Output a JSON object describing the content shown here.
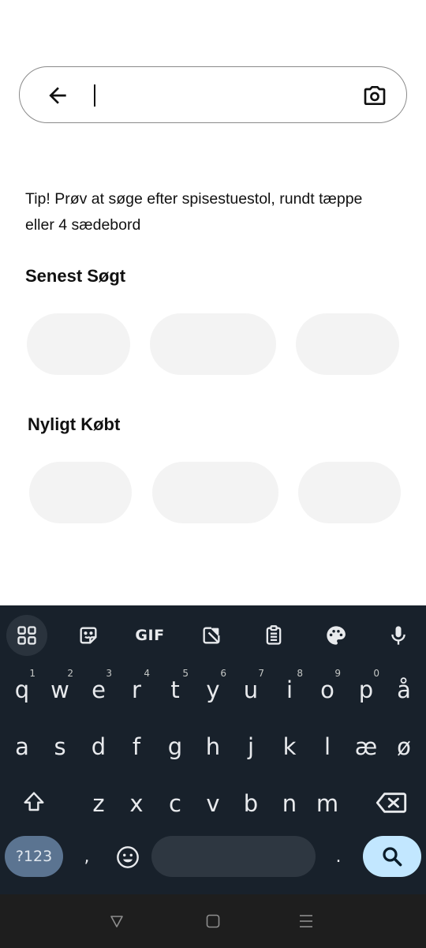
{
  "search": {
    "value": "",
    "placeholder": ""
  },
  "tip": "Tip! Prøv at søge efter spisestuestol, rundt tæppe eller 4 sædebord",
  "recent_searches": {
    "title": "Senest Søgt",
    "chips": [
      "",
      "",
      ""
    ]
  },
  "recently_bought": {
    "title": "Nyligt Købt",
    "chips": [
      "",
      "",
      ""
    ]
  },
  "keyboard": {
    "toolbar": [
      "apps-grid-icon",
      "sticker-icon",
      "gif-icon",
      "image-edit-icon",
      "clipboard-icon",
      "palette-icon",
      "microphone-icon"
    ],
    "gif_label": "GIF",
    "row1": [
      {
        "key": "q",
        "hint": "1"
      },
      {
        "key": "w",
        "hint": "2"
      },
      {
        "key": "e",
        "hint": "3"
      },
      {
        "key": "r",
        "hint": "4"
      },
      {
        "key": "t",
        "hint": "5"
      },
      {
        "key": "y",
        "hint": "6"
      },
      {
        "key": "u",
        "hint": "7"
      },
      {
        "key": "i",
        "hint": "8"
      },
      {
        "key": "o",
        "hint": "9"
      },
      {
        "key": "p",
        "hint": "0"
      },
      {
        "key": "å",
        "hint": ""
      }
    ],
    "row2": [
      "a",
      "s",
      "d",
      "f",
      "g",
      "h",
      "j",
      "k",
      "l",
      "æ",
      "ø"
    ],
    "row3": [
      "z",
      "x",
      "c",
      "v",
      "b",
      "n",
      "m"
    ],
    "symbols_label": "?123",
    "comma": ",",
    "period": ".",
    "colors": {
      "background": "#18212b",
      "action": "#c2e7ff",
      "symbols": "#5b7491"
    }
  },
  "navbar": [
    "back-triangle-icon",
    "home-square-icon",
    "recents-menu-icon"
  ]
}
